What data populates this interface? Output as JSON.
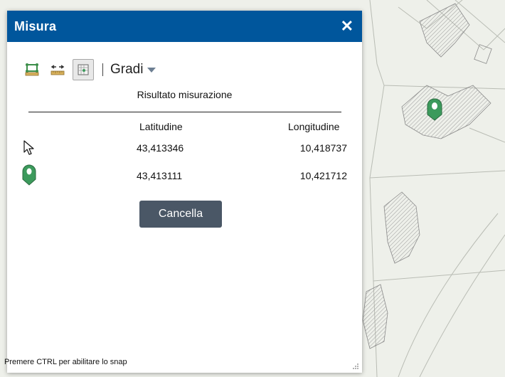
{
  "dialog": {
    "title": "Misura",
    "close_glyph": "✕",
    "unit": "Gradi",
    "result_label": "Risultato misurazione",
    "columns": {
      "latitude": "Latitudine",
      "longitude": "Longitudine"
    },
    "rows": [
      {
        "marker": "cursor-icon",
        "latitude": "43,413346",
        "longitude": "10,418737"
      },
      {
        "marker": "green-pin-icon",
        "latitude": "43,413111",
        "longitude": "10,421712"
      }
    ],
    "clear_label": "Cancella",
    "snap_hint": "Premere CTRL per abilitare lo snap"
  },
  "toolbar": {
    "tools": [
      {
        "name": "area-tool-icon",
        "active": false
      },
      {
        "name": "distance-tool-icon",
        "active": false
      },
      {
        "name": "location-tool-icon",
        "active": true
      }
    ]
  },
  "colors": {
    "titlebar": "#00569c",
    "button": "#4a5766",
    "pin": "#3c9a5c",
    "map_bg": "#eef0ea"
  }
}
